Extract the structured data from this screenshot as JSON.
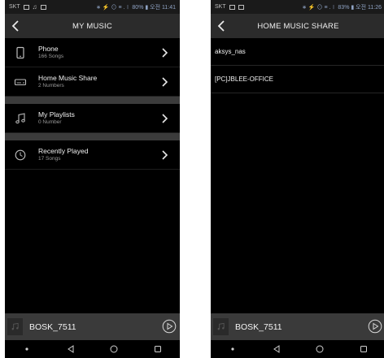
{
  "colors": {
    "background": "#000000",
    "header": "#2b2b2b",
    "separator": "#3b3b3b",
    "player": "#3a3a3a",
    "text": "#f2f2f2",
    "subtext": "#9a9a9a"
  },
  "left": {
    "status": {
      "carrier": "SKT",
      "right": "∗ ⚡ ⊙ ≡ .∣ 80% ▮ 오전 11:41"
    },
    "title": "MY MUSIC",
    "items": [
      {
        "label": "Phone",
        "sub": "166 Songs",
        "icon": "smartphone-icon"
      },
      {
        "label": "Home Music Share",
        "sub": "2 Numbers",
        "icon": "network-drive-icon"
      },
      {
        "label": "My Playlists",
        "sub": "0 Number",
        "icon": "music-note-icon"
      },
      {
        "label": "Recently Played",
        "sub": "17 Songs",
        "icon": "clock-icon"
      }
    ],
    "player": {
      "name": "BOSK_7511"
    }
  },
  "right": {
    "status": {
      "carrier": "SKT",
      "right": "∗ ⚡ ⊙ ≡ .∣ 83% ▮ 오전 11:26"
    },
    "title": "HOME MUSIC SHARE",
    "items": [
      {
        "label": "aksys_nas"
      },
      {
        "label": "[PC]JBLEE-OFFICE"
      }
    ],
    "player": {
      "name": "BOSK_7511"
    }
  }
}
